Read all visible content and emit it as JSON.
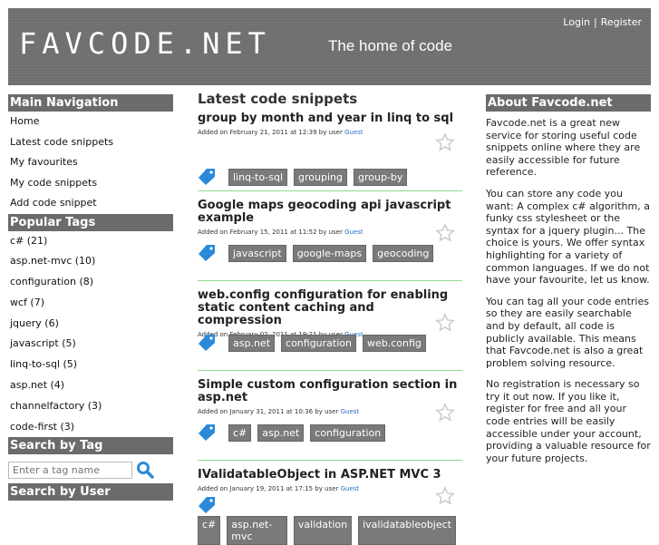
{
  "header": {
    "logo": "FAVCODE.NET",
    "tagline": "The home of code",
    "login": "Login",
    "separator": "|",
    "register": "Register"
  },
  "main_nav": {
    "title": "Main Navigation",
    "items": [
      "Home",
      "Latest code snippets",
      "My favourites",
      "My code snippets",
      "Add code snippet"
    ]
  },
  "popular_tags": {
    "title": "Popular Tags",
    "items": [
      "c# (21)",
      "asp.net-mvc (10)",
      "configuration (8)",
      "wcf (7)",
      "jquery (6)",
      "javascript (5)",
      "linq-to-sql (5)",
      "asp.net (4)",
      "channelfactory (3)",
      "code-first (3)"
    ]
  },
  "search_by_tag": {
    "title": "Search by Tag",
    "placeholder": "Enter a tag name"
  },
  "search_by_user": {
    "title": "Search by User"
  },
  "latest": {
    "title": "Latest code snippets",
    "snippets": [
      {
        "title": "group by month and year in linq to sql",
        "meta": "Added on February 21, 2011 at 12:39 by user",
        "user": "Guest",
        "tags": [
          "linq-to-sql",
          "grouping",
          "group-by"
        ]
      },
      {
        "title": "Google maps geocoding api javascript example",
        "meta": "Added on February 15, 2011 at 11:52 by user",
        "user": "Guest",
        "tags": [
          "javascript",
          "google-maps",
          "geocoding"
        ]
      },
      {
        "title": "web.config configuration for enabling static content caching and compression",
        "meta": "Added on February 02, 2011 at 19:21 by user",
        "user": "Guest",
        "tags": [
          "asp.net",
          "configuration",
          "web.config"
        ]
      },
      {
        "title": "Simple custom configuration section in asp.net",
        "meta": "Added on January 31, 2011 at 10:36 by user",
        "user": "Guest",
        "tags": [
          "c#",
          "asp.net",
          "configuration"
        ]
      },
      {
        "title": "IValidatableObject in ASP.NET MVC 3",
        "meta": "Added on January 19, 2011 at 17:15 by user",
        "user": "Guest",
        "tags": [
          "c#",
          "asp.net-mvc",
          "validation",
          "ivalidatableobject"
        ]
      }
    ]
  },
  "about": {
    "title": "About Favcode.net",
    "paragraphs": [
      "Favcode.net is a great new service for storing useful code snippets online where they are easily accessible for future reference.",
      "You can store any code you want: A complex c# algorithm, a funky css stylesheet or the syntax for a jquery plugin... The choice is yours. We offer syntax highlighting for a variety of common languages. If we do not have your favourite, let us know.",
      "You can tag all your code entries so they are easily searchable and by default, all code is publicly available. This means that Favcode.net is also a great problem solving resource.",
      "No registration is necessary so try it out now. If you like it, register for free and all your code entries will be easily accessible under your account, providing a valuable resource for your future projects."
    ]
  },
  "colors": {
    "header_bg": "#6f6f6f",
    "section_title_bg": "#6b6b6b",
    "tag_pill_bg": "#7a7a7a",
    "divider_green": "#8fd98f",
    "tag_icon_blue": "#2a8ad9",
    "user_link": "#2a6fc9"
  },
  "icons": {
    "search": "search-icon",
    "tag": "tag-icon",
    "star": "star-icon"
  }
}
